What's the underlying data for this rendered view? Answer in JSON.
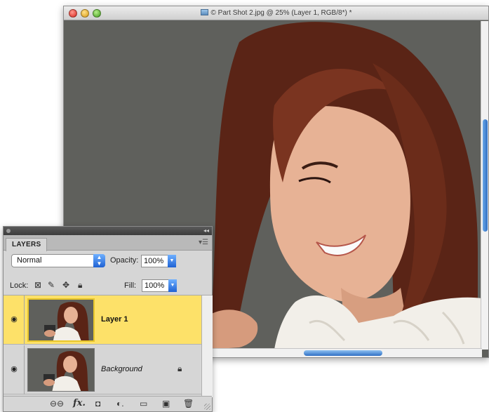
{
  "document_window": {
    "title": "© Part Shot 2.jpg @ 25% (Layer 1, RGB/8*) *",
    "traffic_lights": [
      "close-light",
      "minimize-light",
      "zoom-light"
    ],
    "canvas_bg": "#5f605c"
  },
  "layers_panel": {
    "tab_label": "LAYERS",
    "blend_mode": "Normal",
    "opacity_label": "Opacity:",
    "opacity_value": "100%",
    "lock_label": "Lock:",
    "fill_label": "Fill:",
    "fill_value": "100%",
    "layers": [
      {
        "name": "Layer 1",
        "selected": true,
        "visible": true
      },
      {
        "name": "Background",
        "selected": false,
        "visible": true,
        "locked": true
      }
    ],
    "footer_icons": [
      "link-layers-icon",
      "fx-icon",
      "layer-mask-icon",
      "adjustment-layer-icon",
      "new-group-icon",
      "new-layer-icon",
      "trash-icon"
    ],
    "fx_label": "fx.",
    "selected_color": "#fde169"
  }
}
